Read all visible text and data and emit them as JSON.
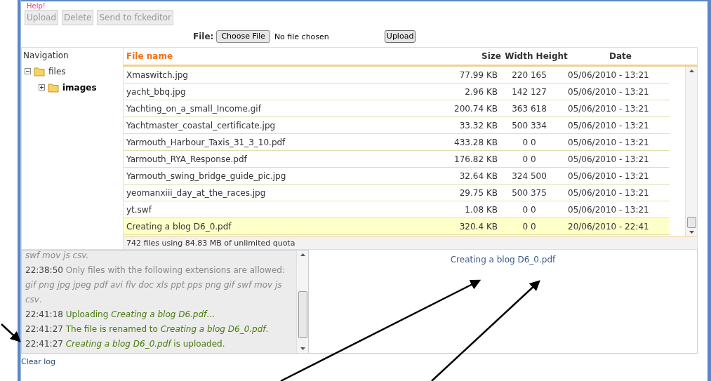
{
  "help_link": "Help!",
  "toolbar": [
    {
      "label": "Upload",
      "disabled": true
    },
    {
      "label": "Delete",
      "disabled": true
    },
    {
      "label": "Send to fckeditor",
      "disabled": true
    }
  ],
  "upload_form": {
    "label": "File:",
    "choose_button": "Choose File",
    "file_status": "No file chosen",
    "submit": "Upload"
  },
  "navigation": {
    "title": "Navigation",
    "tree": [
      {
        "name": "files",
        "expanded": true,
        "selected": false,
        "children": [
          {
            "name": "images",
            "expanded": false,
            "selected": true
          }
        ]
      }
    ]
  },
  "table": {
    "columns": [
      "File name",
      "Size",
      "Width Height",
      "Date"
    ],
    "rows": [
      {
        "name": "Xmaswitch.jpg",
        "size": "77.99 KB",
        "dims": "220 165",
        "date": "05/06/2010 - 13:21",
        "selected": false
      },
      {
        "name": "yacht_bbq.jpg",
        "size": "2.96 KB",
        "dims": "142 127",
        "date": "05/06/2010 - 13:21",
        "selected": false
      },
      {
        "name": "Yachting_on_a_small_Income.gif",
        "size": "200.74 KB",
        "dims": "363 618",
        "date": "05/06/2010 - 13:21",
        "selected": false
      },
      {
        "name": "Yachtmaster_coastal_certificate.jpg",
        "size": "33.32 KB",
        "dims": "500 334",
        "date": "05/06/2010 - 13:21",
        "selected": false
      },
      {
        "name": "Yarmouth_Harbour_Taxis_31_3_10.pdf",
        "size": "433.28 KB",
        "dims": "0 0",
        "date": "05/06/2010 - 13:21",
        "selected": false
      },
      {
        "name": "Yarmouth_RYA_Response.pdf",
        "size": "176.82 KB",
        "dims": "0 0",
        "date": "05/06/2010 - 13:21",
        "selected": false
      },
      {
        "name": "Yarmouth_swing_bridge_guide_pic.jpg",
        "size": "32.64 KB",
        "dims": "324 500",
        "date": "05/06/2010 - 13:21",
        "selected": false
      },
      {
        "name": "yeomanxiii_day_at_the_races.jpg",
        "size": "29.75 KB",
        "dims": "500 375",
        "date": "05/06/2010 - 13:21",
        "selected": false
      },
      {
        "name": "yt.swf",
        "size": "1.08 KB",
        "dims": "0 0",
        "date": "05/06/2010 - 13:21",
        "selected": false
      },
      {
        "name": "Creating a blog D6_0.pdf",
        "size": "320.4 KB",
        "dims": "0 0",
        "date": "20/06/2010 - 22:41",
        "selected": true
      }
    ],
    "footer": "742 files using 84.83 MB of unlimited quota"
  },
  "log": [
    {
      "kind": "error",
      "message": "*swf mov js csv.*"
    },
    {
      "kind": "error",
      "time": "22:38:50",
      "message": "Only files with the following extensions are allowed: *gif png jpg jpeg pdf avi flv doc xls ppt pps png gif swf mov js csv*."
    },
    {
      "kind": "success",
      "time": "22:41:18",
      "message": "Uploading *Creating a blog D6.pdf*..."
    },
    {
      "kind": "success",
      "time": "22:41:27",
      "message": "The file is renamed to *Creating a blog D6_0.pdf*."
    },
    {
      "kind": "success",
      "time": "22:41:27",
      "message": "*Creating a blog D6_0.pdf* is uploaded."
    }
  ],
  "preview": {
    "filename": "Creating a blog D6_0.pdf"
  },
  "clear_log": "Clear log"
}
